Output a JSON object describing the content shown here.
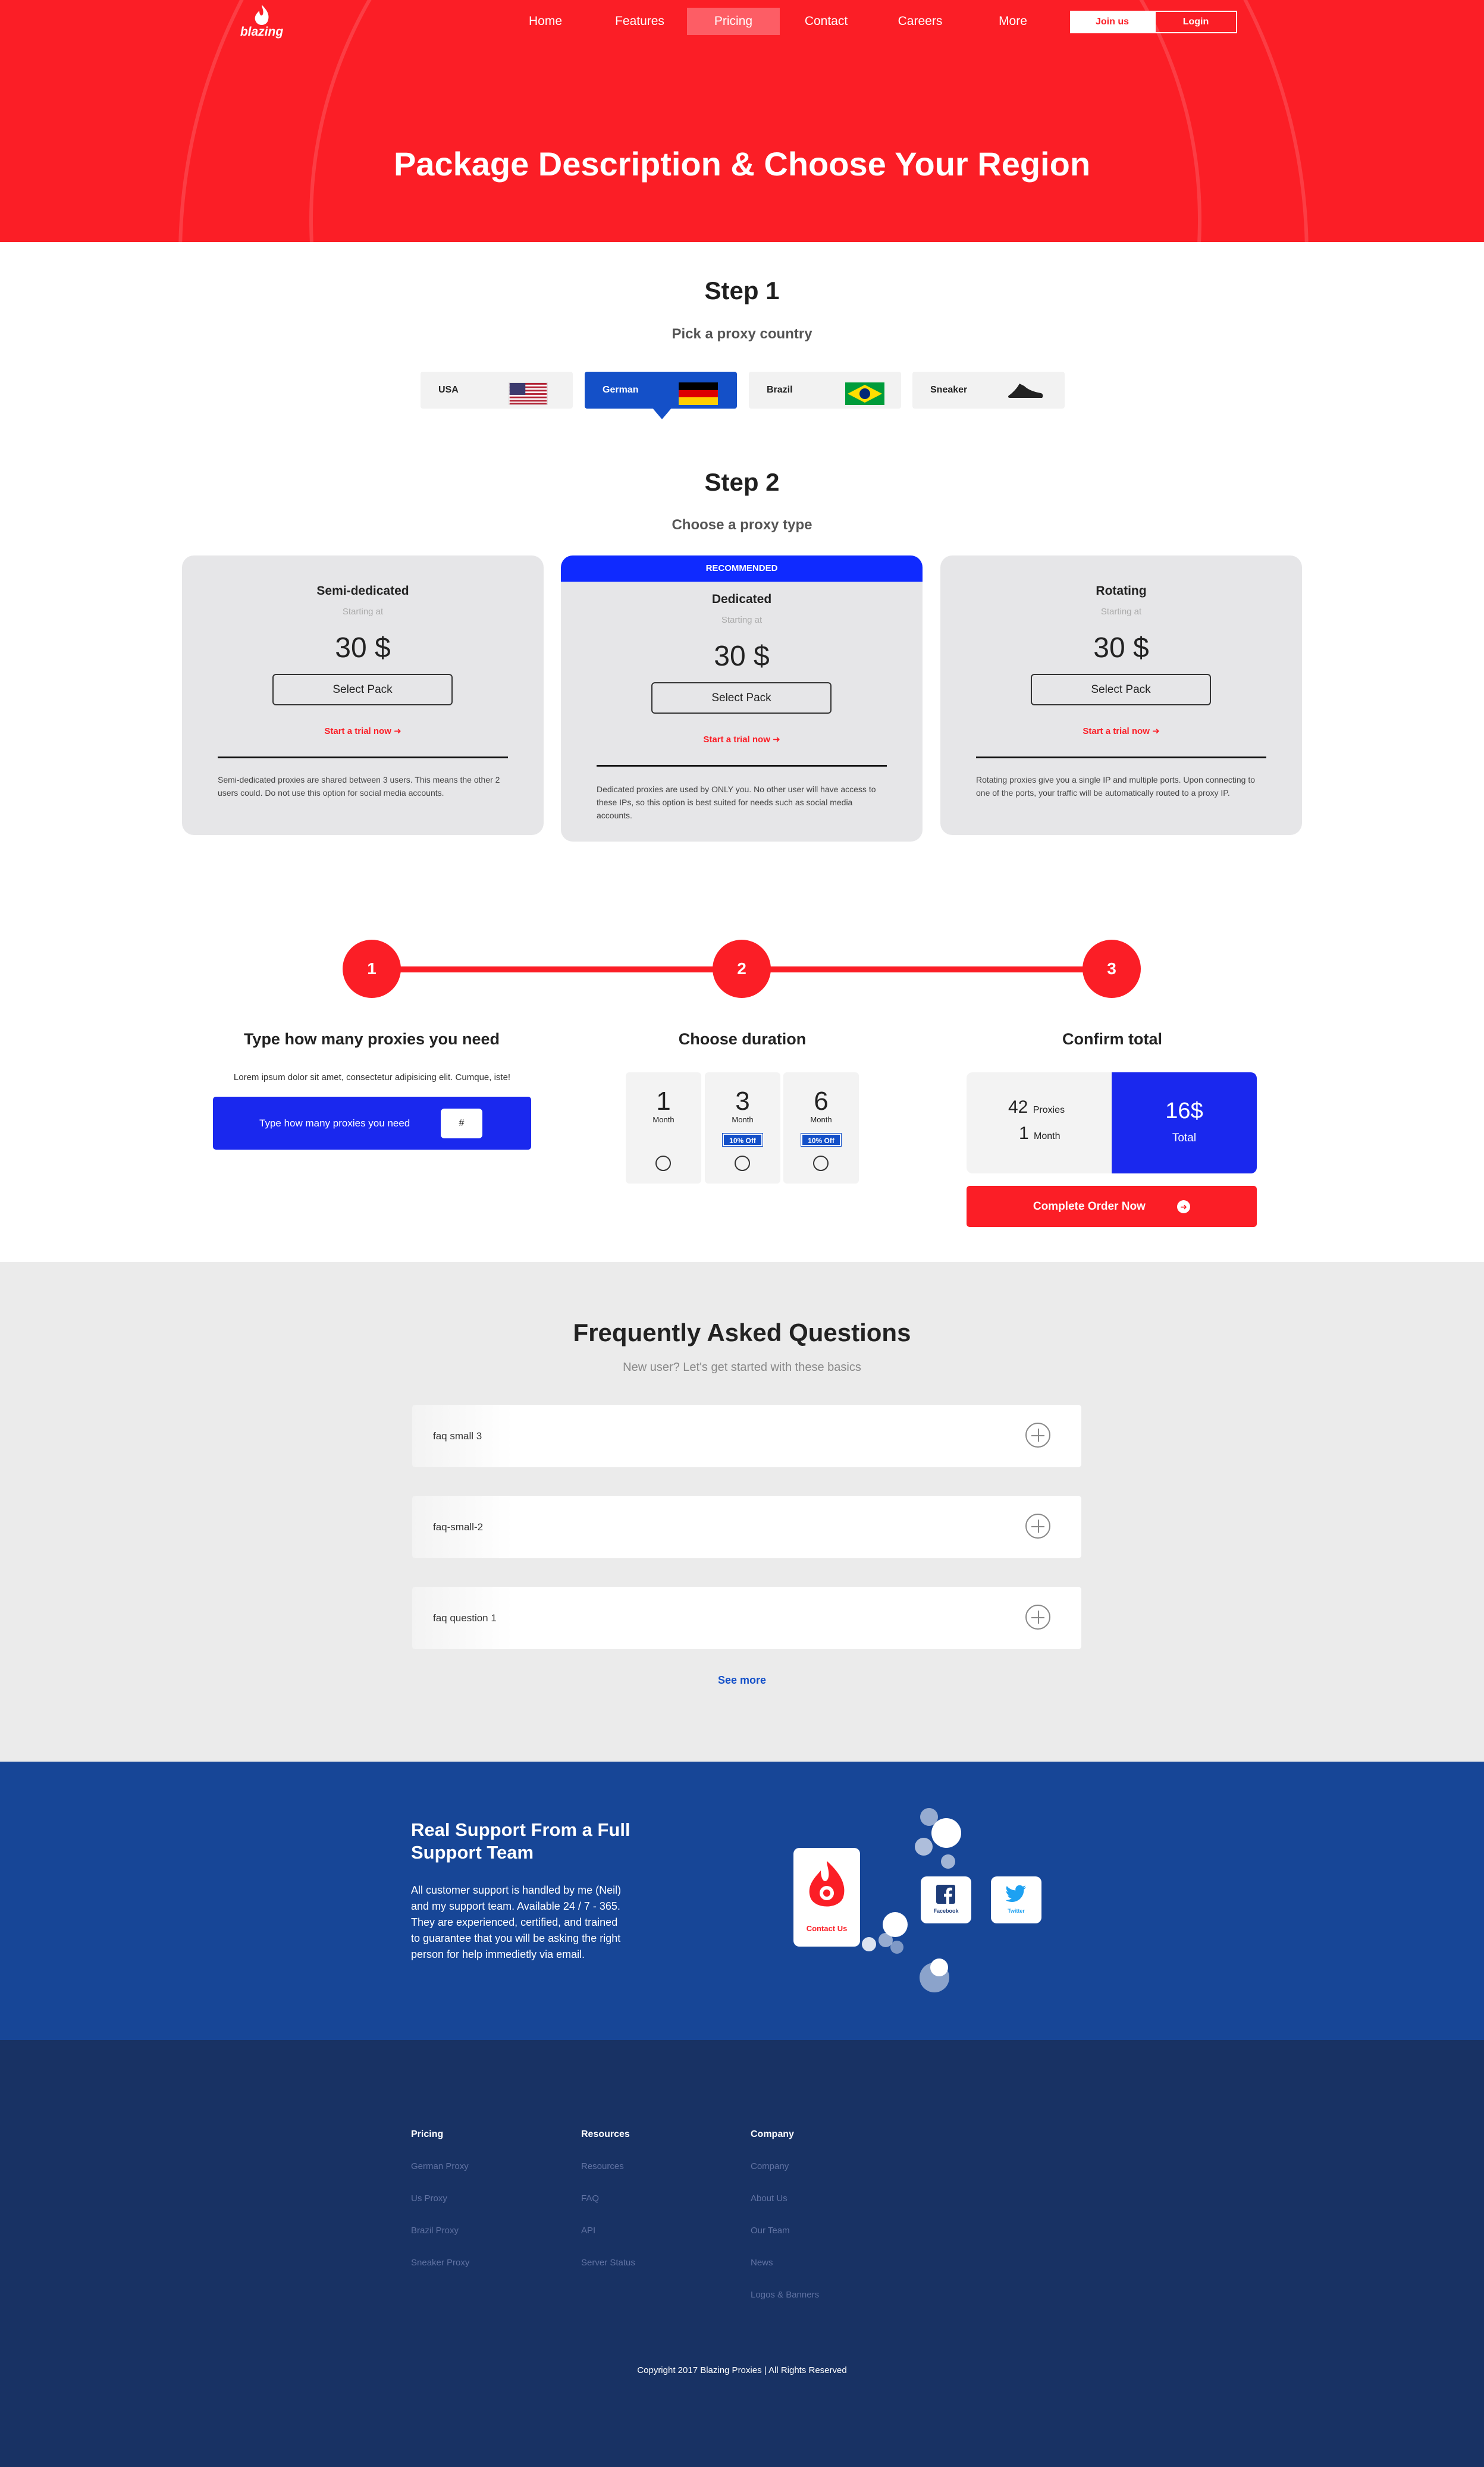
{
  "brand": {
    "logo_text": "blazing"
  },
  "nav": {
    "items": [
      "Home",
      "Features",
      "Pricing",
      "Contact",
      "Careers",
      "More"
    ],
    "active": "Pricing",
    "join": "Join us",
    "login": "Login"
  },
  "hero": {
    "title": "Package Description & Choose Your Region"
  },
  "step1": {
    "title": "Step 1",
    "subtitle": "Pick a proxy country",
    "countries": [
      {
        "label": "USA",
        "icon": "usa-flag-icon"
      },
      {
        "label": "German",
        "icon": "germany-flag-icon",
        "selected": true
      },
      {
        "label": "Brazil",
        "icon": "brazil-flag-icon"
      },
      {
        "label": "Sneaker",
        "icon": "sneaker-icon"
      }
    ]
  },
  "step2": {
    "title": "Step 2",
    "subtitle": "Choose a proxy type",
    "cards": [
      {
        "title": "Semi-dedicated",
        "starting": "Starting at",
        "price": "30 $",
        "button": "Select Pack",
        "trial": "Start a trial now",
        "desc": "Semi-dedicated proxies are shared between 3 users. This means the other 2 users could. Do not use this option for social media accounts."
      },
      {
        "badge": "RECOMMENDED",
        "title": "Dedicated",
        "starting": "Starting at",
        "price": "30 $",
        "button": "Select Pack",
        "trial": "Start a trial now",
        "desc": "Dedicated proxies are used by ONLY you. No other user will have access to these IPs, so this option is best suited for needs such as social media accounts."
      },
      {
        "title": "Rotating",
        "starting": "Starting at",
        "price": "30 $",
        "button": "Select Pack",
        "trial": "Start a trial now",
        "desc": "Rotating proxies give you a single IP and multiple ports. Upon connecting to one of the ports, your traffic will be automatically routed to a proxy IP."
      }
    ]
  },
  "progress": {
    "steps": [
      "1",
      "2",
      "3"
    ],
    "titles": [
      "Type how many proxies you need",
      "Choose duration",
      "Confirm total"
    ],
    "lorem": "Lorem ipsum dolor sit amet, consectetur adipisicing elit. Cumque, iste!",
    "qty_label": "Type how many proxies you need",
    "qty_placeholder": "#",
    "durations": [
      {
        "num": "1",
        "unit": "Month"
      },
      {
        "num": "3",
        "unit": "Month",
        "badge": "10% Off"
      },
      {
        "num": "6",
        "unit": "Month",
        "badge": "10% Off"
      }
    ],
    "total": {
      "proxies_num": "42",
      "proxies_lbl": "Proxies",
      "month_num": "1",
      "month_lbl": "Month",
      "price": "16$",
      "price_lbl": "Total"
    },
    "order": "Complete Order Now"
  },
  "faq": {
    "title": "Frequently Asked Questions",
    "subtitle": "New user? Let's get started with these basics",
    "items": [
      "faq small 3",
      "faq-small-2",
      "faq question 1"
    ],
    "see_more": "See more"
  },
  "support": {
    "title": "Real Support From a Full Support Team",
    "text": "All customer support is handled by me (Neil) and my support team. Available 24 / 7 - 365. They are experienced, certified, and trained to guarantee that you will be asking the right person for help immedietly via email.",
    "contact": "Contact Us",
    "facebook": "Facebook",
    "twitter": "Twitter"
  },
  "footer": {
    "cols": [
      {
        "title": "Pricing",
        "links": [
          "German Proxy",
          "Us Proxy",
          "Brazil Proxy",
          "Sneaker Proxy"
        ]
      },
      {
        "title": "Resources",
        "links": [
          "Resources",
          "FAQ",
          "API",
          "Server Status"
        ]
      },
      {
        "title": "Company",
        "links": [
          "Company",
          "About Us",
          "Our Team",
          "News",
          "Logos & Banners"
        ]
      }
    ],
    "copyright": "Copyright 2017 Blazing Proxies | All Rights Reserved"
  },
  "colors": {
    "red": "#fb1e26",
    "blue": "#1a28ee",
    "navy": "#183264",
    "support_blue": "#174697"
  }
}
